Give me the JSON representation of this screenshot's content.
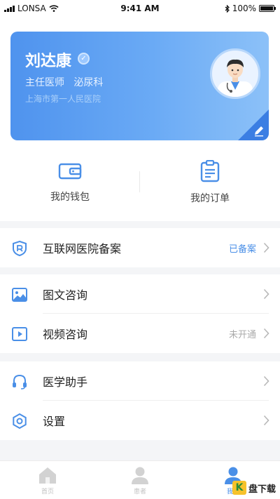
{
  "status_bar": {
    "carrier": "LONSA",
    "time": "9:41 AM",
    "battery": "100%"
  },
  "doctor": {
    "name": "刘达康",
    "title": "主任医师",
    "department": "泌尿科",
    "hospital": "上海市第一人民医院"
  },
  "quick_actions": [
    {
      "label": "我的钱包",
      "icon": "wallet-icon"
    },
    {
      "label": "我的订单",
      "icon": "clipboard-icon"
    }
  ],
  "sections": [
    {
      "rows": [
        {
          "label": "互联网医院备案",
          "icon": "shield-icon",
          "status": "已备案",
          "status_color": "#4a8fe7"
        }
      ]
    },
    {
      "rows": [
        {
          "label": "图文咨询",
          "icon": "image-icon",
          "status": ""
        },
        {
          "label": "视频咨询",
          "icon": "video-icon",
          "status": "未开通",
          "status_color": "#aaaaaa"
        }
      ]
    },
    {
      "rows": [
        {
          "label": "医学助手",
          "icon": "headset-icon",
          "status": ""
        },
        {
          "label": "设置",
          "icon": "settings-icon",
          "status": ""
        }
      ]
    }
  ],
  "tabbar": [
    {
      "label": "首页",
      "icon": "home-icon"
    },
    {
      "label": "患者",
      "icon": "patients-icon"
    },
    {
      "label": "我的",
      "icon": "profile-icon",
      "active": true
    }
  ],
  "watermark": {
    "brand": "盘下载",
    "logo_text": "K"
  },
  "colors": {
    "accent": "#4a8fe7",
    "card_start": "#4f93ee",
    "card_end": "#8cc1f8",
    "background": "#f4f5f7"
  }
}
